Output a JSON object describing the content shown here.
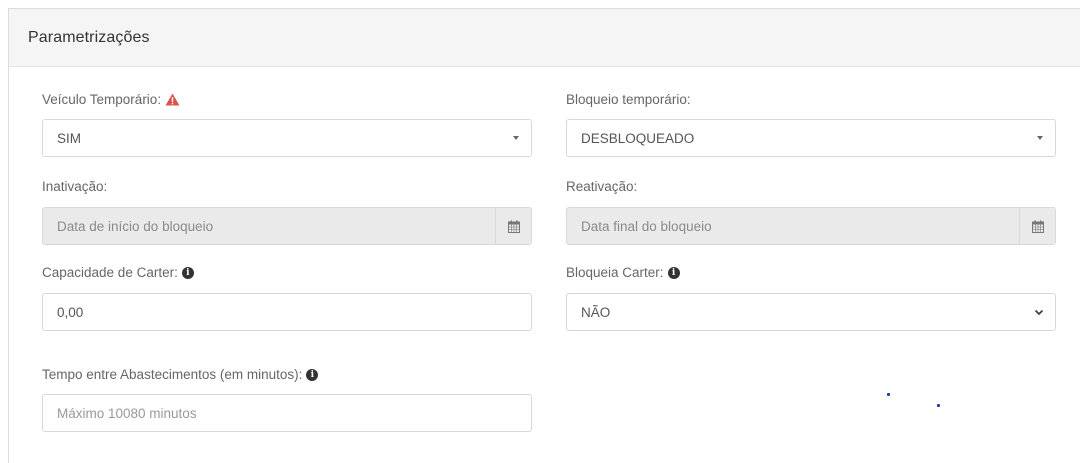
{
  "panel": {
    "title": "Parametrizações"
  },
  "fields": {
    "veiculo_temporario": {
      "label": "Veículo Temporário:",
      "value": "SIM"
    },
    "bloqueio_temporario": {
      "label": "Bloqueio temporário:",
      "value": "DESBLOQUEADO"
    },
    "inativacao": {
      "label": "Inativação:",
      "placeholder": "Data de início do bloqueio"
    },
    "reativacao": {
      "label": "Reativação:",
      "placeholder": "Data final do bloqueio"
    },
    "capacidade_carter": {
      "label": "Capacidade de Carter:",
      "value": "0,00"
    },
    "bloqueia_carter": {
      "label": "Bloqueia Carter:",
      "value": "NÃO"
    },
    "tempo_abastecimentos": {
      "label": "Tempo entre Abastecimentos (em minutos):",
      "placeholder": "Máximo 10080 minutos"
    }
  },
  "icons": {
    "warning": "warning-triangle-icon",
    "info": "info-circle-icon",
    "calendar": "calendar-icon",
    "caret": "caret-down-icon",
    "chevron": "chevron-down-icon"
  },
  "colors": {
    "warning": "#d9534f",
    "header_bg": "#f5f5f5",
    "disabled_bg": "#eaeaea"
  }
}
